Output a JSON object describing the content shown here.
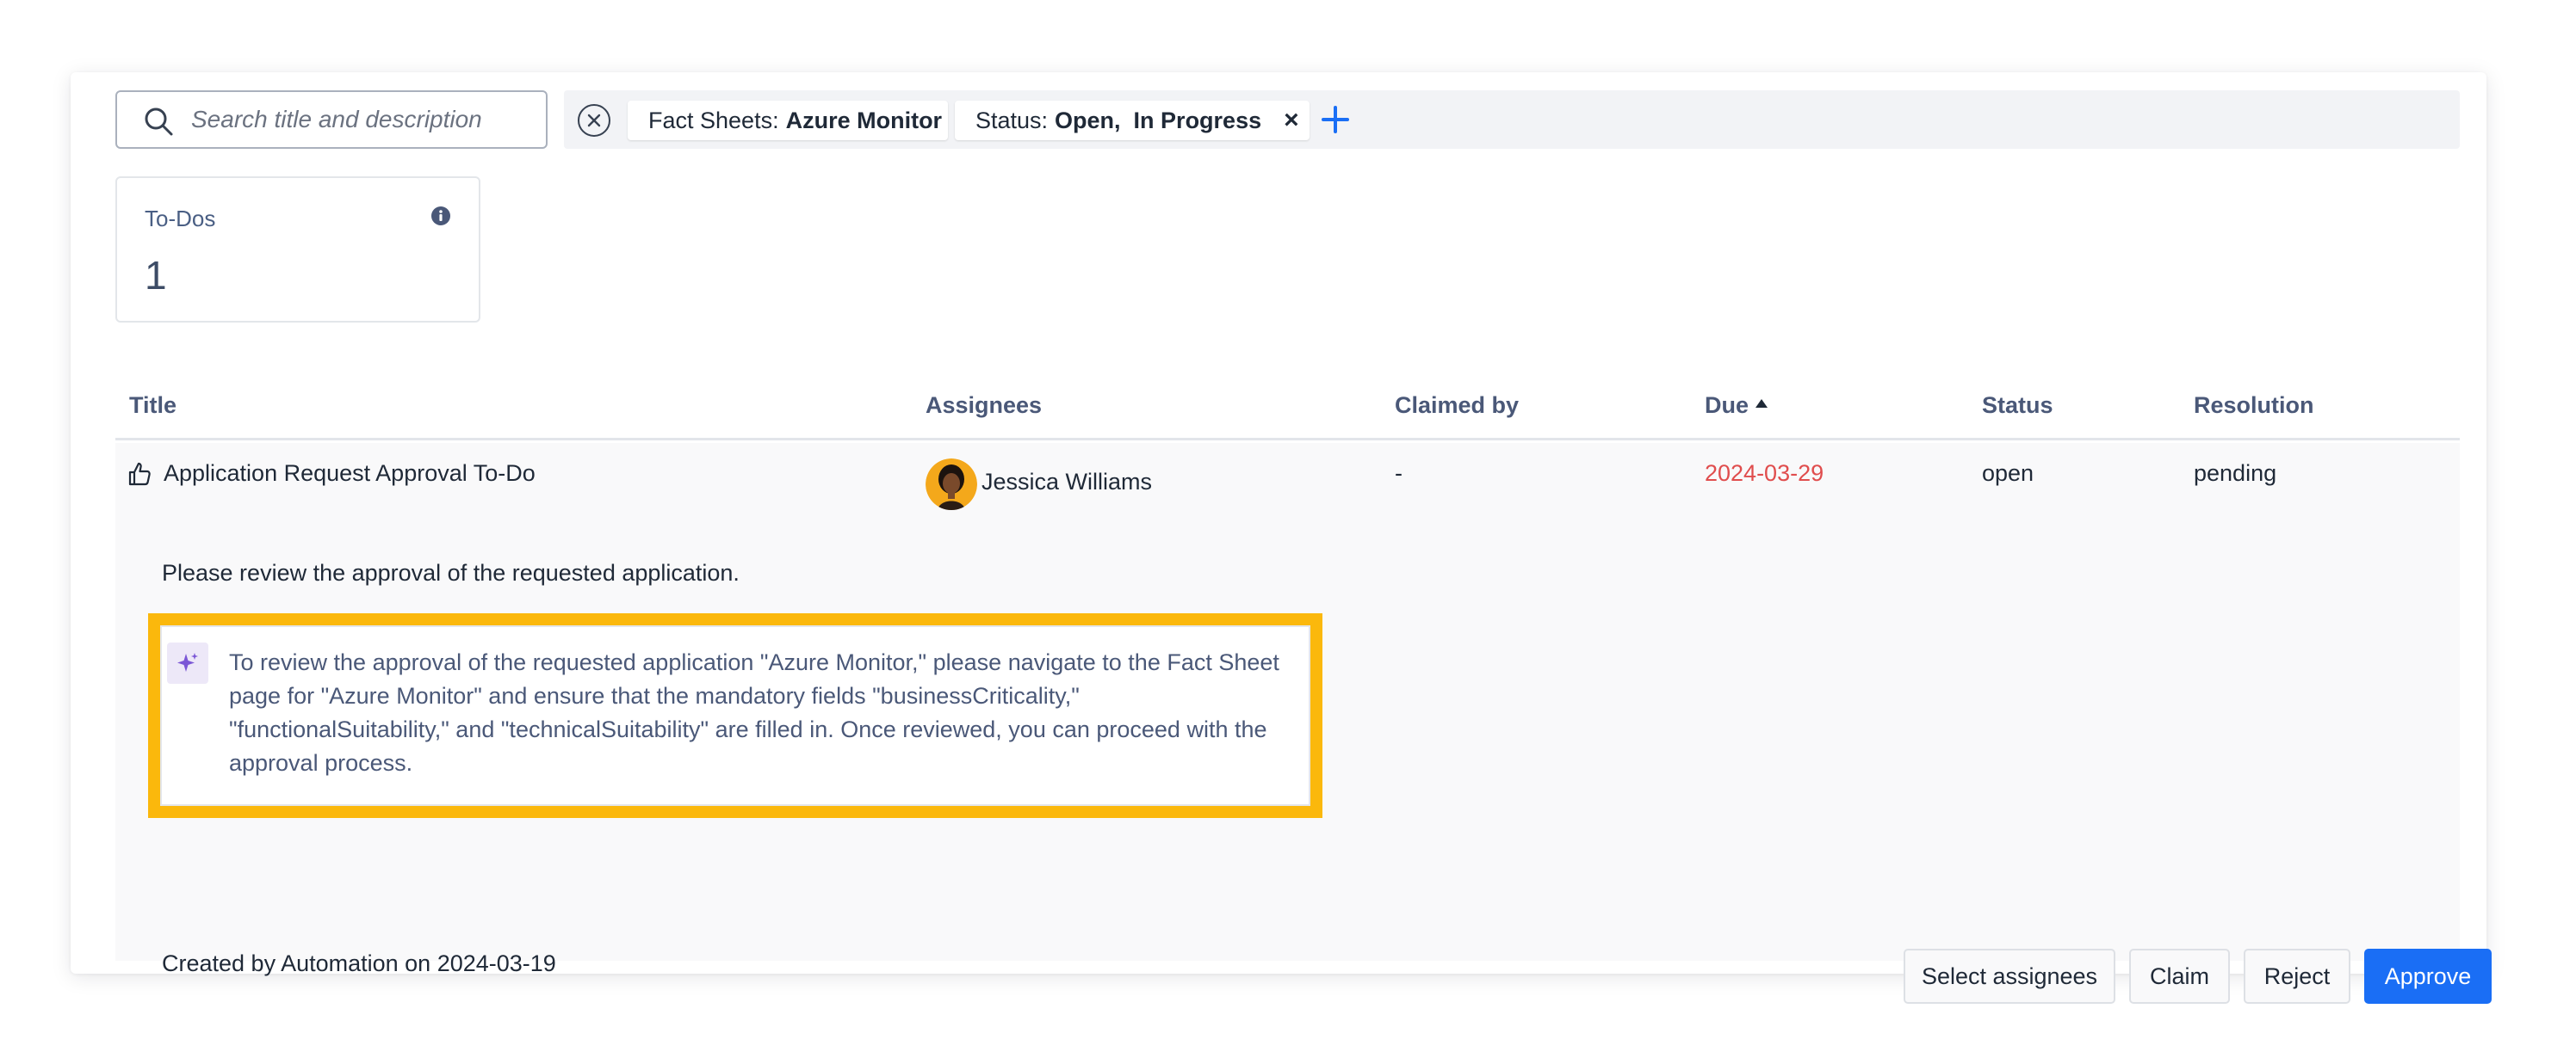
{
  "search": {
    "placeholder": "Search title and description",
    "icon": "search-icon"
  },
  "filters": [
    {
      "key": "Fact Sheets:",
      "value": "Azure Monitor"
    },
    {
      "key": "Status:",
      "value": "Open,  In Progress",
      "remove": "×"
    }
  ],
  "counter": {
    "label": "To-Dos",
    "value": "1"
  },
  "table": {
    "columns": [
      "Title",
      "Assignees",
      "Claimed by",
      "Due",
      "Status",
      "Resolution"
    ],
    "sorted_column": "Due",
    "rows": [
      {
        "title": "Application Request Approval To-Do",
        "assignee": "Jessica Williams",
        "claimed_by": "-",
        "due": "2024-03-29",
        "status": "open",
        "resolution": "pending",
        "description": "Please review the approval of the requested application.",
        "ai_summary": "To review the approval of the requested application \"Azure Monitor,\" please navigate to the Fact Sheet page for \"Azure Monitor\" and ensure that the mandatory fields \"businessCriticality,\" \"functionalSuitability,\" and \"technicalSuitability\" are filled in. Once reviewed, you can proceed with the approval process.",
        "created": "Created by Automation on 2024-03-19"
      }
    ]
  },
  "actions": {
    "select_assignees": "Select assignees",
    "claim": "Claim",
    "reject": "Reject",
    "approve": "Approve"
  },
  "colors": {
    "accent": "#1a6ef5",
    "due_overdue": "#e04d4d",
    "highlight": "#fbb80c"
  }
}
